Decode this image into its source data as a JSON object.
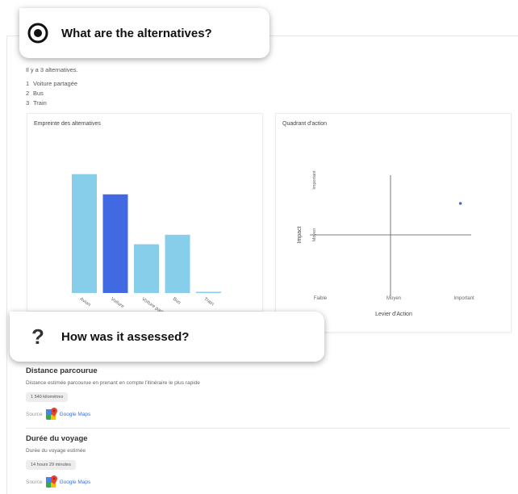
{
  "callout_top": {
    "icon": "target-icon",
    "text": "What are the alternatives?"
  },
  "callout_mid": {
    "icon": "question-mark-icon",
    "text": "How was it assessed?"
  },
  "intro": "Il y a 3 alternatives.",
  "alternatives": [
    {
      "num": "1",
      "label": "Voiture partagée"
    },
    {
      "num": "2",
      "label": "Bus"
    },
    {
      "num": "3",
      "label": "Train"
    }
  ],
  "footprint_card": {
    "title": "Empreinte des alternatives"
  },
  "quadrant_card": {
    "title": "Quadrant d'action"
  },
  "chart_data": [
    {
      "type": "bar",
      "title": "Empreinte des alternatives",
      "categories": [
        "Avion",
        "Voiture",
        "Voiture partagée",
        "Bus",
        "Train"
      ],
      "values": [
        100,
        83,
        41,
        49,
        1
      ],
      "colors": [
        "#87ceeb",
        "#4169e1",
        "#87ceeb",
        "#87ceeb",
        "#87ceeb"
      ],
      "ylim": [
        0,
        110
      ],
      "grid": false
    },
    {
      "type": "scatter",
      "title": "Quadrant d'action",
      "xlabel": "Levier d'Action",
      "ylabel": "Impact",
      "x_ticks": [
        "Faible",
        "Moyen",
        "Important"
      ],
      "y_ticks": [
        "Moyen",
        "Important"
      ],
      "points": [
        {
          "x": 2.8,
          "y": 2.3
        }
      ],
      "xlim": [
        0,
        3
      ],
      "ylim": [
        0,
        3
      ],
      "point_color": "#3b6fd8"
    }
  ],
  "sections": [
    {
      "title": "Distance parcourue",
      "desc": "Distance estimée parcourue en prenant en compte l'itinéraire le plus rapide",
      "value": "1 540 kilomètres",
      "source_label": "Source",
      "source_link": "Google Maps"
    },
    {
      "title": "Durée du voyage",
      "desc": "Durée du voyage estimée",
      "value": "14 hours 29 minutes",
      "source_label": "Source",
      "source_link": "Google Maps"
    }
  ]
}
